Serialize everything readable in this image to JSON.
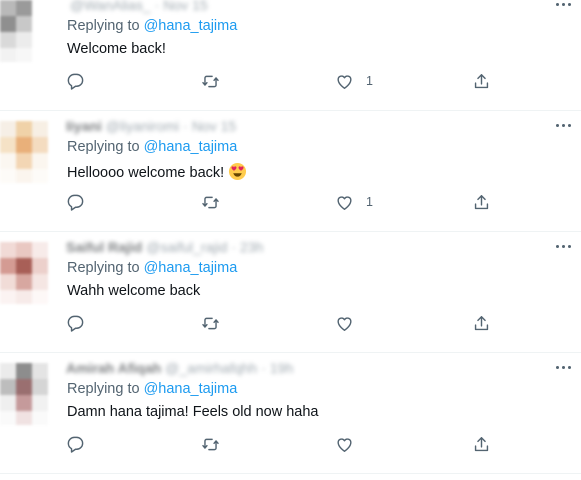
{
  "tweets": [
    {
      "author_name": "",
      "author_handle": "@WanAlias_",
      "date": "Nov 15",
      "replying_prefix": "Replying to",
      "replying_to": "@hana_tajima",
      "text": "Welcome back!",
      "like_count": "1",
      "avatar_colors": [
        "#b9b9b9",
        "#9a9a9a",
        "#ffffff",
        "#8f8f8f",
        "#c8c8c8",
        "#ffffff",
        "#d9d9d9",
        "#ececec",
        "#ffffff",
        "#f2f2f2",
        "#f7f7f7",
        "#ffffff"
      ]
    },
    {
      "author_name": "Iiyani",
      "author_handle": "@liyaniromi",
      "date": "Nov 15",
      "replying_prefix": "Replying to",
      "replying_to": "@hana_tajima",
      "text": "Helloooo welcome back!",
      "emoji": "smiling-face-with-heart-eyes",
      "like_count": "1",
      "avatar_colors": [
        "#f6efe6",
        "#f0d2a8",
        "#f7efe4",
        "#f5e2c6",
        "#e9b07a",
        "#f4dcc0",
        "#fbf7f1",
        "#f3d6b4",
        "#fbf6ef",
        "#fdfbf8",
        "#fbf5ee",
        "#fdfbf8"
      ]
    },
    {
      "author_name": "Saiful Rajid",
      "author_handle": "@saiful_rajid",
      "date": "23h",
      "replying_prefix": "Replying to",
      "replying_to": "@hana_tajima",
      "text": "Wahh welcome back",
      "like_count": "",
      "avatar_colors": [
        "#f1dad6",
        "#e9c8c2",
        "#f7ebe9",
        "#d49b93",
        "#a85f57",
        "#ecd0cb",
        "#f1dcd7",
        "#d7a7a0",
        "#f5e6e3",
        "#fbf3f2",
        "#f7ebe9",
        "#fdf8f7"
      ]
    },
    {
      "author_name": "Amirah Afiqah",
      "author_handle": "@_amirhafqhh",
      "date": "19h",
      "replying_prefix": "Replying to",
      "replying_to": "@hana_tajima",
      "text": "Damn hana tajima! Feels old now haha",
      "like_count": "",
      "avatar_colors": [
        "#ebebeb",
        "#8d8d8d",
        "#e4e4e4",
        "#bdbdbd",
        "#9a6f70",
        "#d5d5d5",
        "#efefef",
        "#c59a9b",
        "#f1f1f1",
        "#fafafa",
        "#f0e2e2",
        "#fafafa"
      ]
    }
  ],
  "icons": {
    "reply": "reply-icon",
    "retweet": "retweet-icon",
    "like": "heart-icon",
    "share": "share-icon",
    "more": "more-dots-icon"
  },
  "colors": {
    "accent": "#1d9bf0",
    "secondary_text": "#536471",
    "divider": "#eff3f4"
  }
}
